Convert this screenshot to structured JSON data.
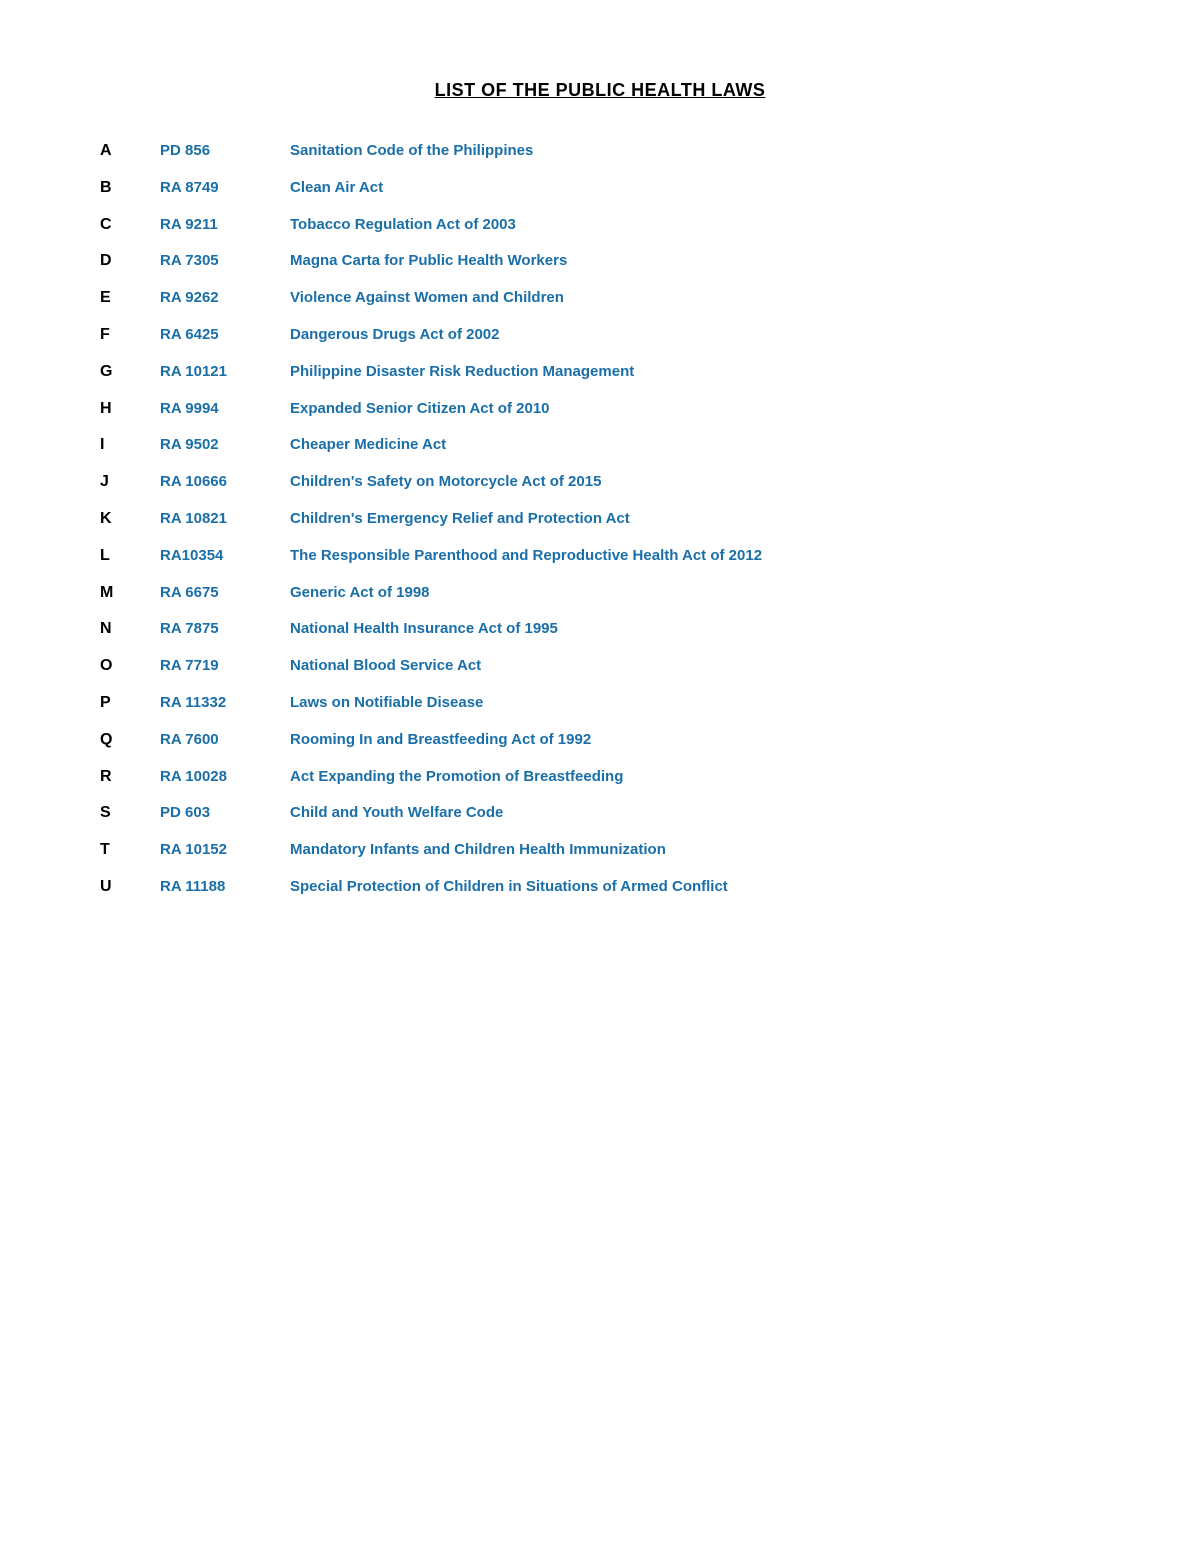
{
  "page": {
    "title": "LIST OF THE PUBLIC HEALTH LAWS"
  },
  "laws": [
    {
      "letter": "A",
      "code": "PD 856",
      "name": "Sanitation Code of the Philippines"
    },
    {
      "letter": "B",
      "code": "RA 8749",
      "name": "Clean Air Act"
    },
    {
      "letter": "C",
      "code": "RA 9211",
      "name": "Tobacco Regulation Act of 2003"
    },
    {
      "letter": "D",
      "code": "RA 7305",
      "name": "Magna Carta for Public Health Workers"
    },
    {
      "letter": "E",
      "code": "RA 9262",
      "name": "Violence Against Women and Children"
    },
    {
      "letter": "F",
      "code": "RA 6425",
      "name": "Dangerous Drugs Act of 2002"
    },
    {
      "letter": "G",
      "code": "RA 10121",
      "name": "Philippine Disaster Risk Reduction Management"
    },
    {
      "letter": "H",
      "code": "RA 9994",
      "name": "Expanded Senior Citizen Act of 2010"
    },
    {
      "letter": "I",
      "code": "RA 9502",
      "name": "Cheaper Medicine Act"
    },
    {
      "letter": "J",
      "code": "RA 10666",
      "name": "Children's Safety on Motorcycle Act of 2015"
    },
    {
      "letter": "K",
      "code": "RA 10821",
      "name": "Children's Emergency Relief and Protection Act"
    },
    {
      "letter": "L",
      "code": "RA10354",
      "name": "The Responsible Parenthood and Reproductive Health Act of 2012"
    },
    {
      "letter": "M",
      "code": "RA 6675",
      "name": "Generic Act of 1998"
    },
    {
      "letter": "N",
      "code": "RA 7875",
      "name": "National Health Insurance Act of 1995"
    },
    {
      "letter": "O",
      "code": "RA 7719",
      "name": "National Blood Service Act"
    },
    {
      "letter": "P",
      "code": "RA 11332",
      "name": "Laws on Notifiable Disease"
    },
    {
      "letter": "Q",
      "code": "RA 7600",
      "name": "Rooming In and Breastfeeding Act of 1992"
    },
    {
      "letter": "R",
      "code": "RA 10028",
      "name": "Act Expanding the Promotion of Breastfeeding"
    },
    {
      "letter": "S",
      "code": "PD 603",
      "name": "Child and Youth Welfare Code"
    },
    {
      "letter": "T",
      "code": "RA 10152",
      "name": "Mandatory Infants and Children Health Immunization"
    },
    {
      "letter": "U",
      "code": "RA 11188",
      "name": "Special Protection of Children in Situations of Armed Conflict"
    }
  ]
}
